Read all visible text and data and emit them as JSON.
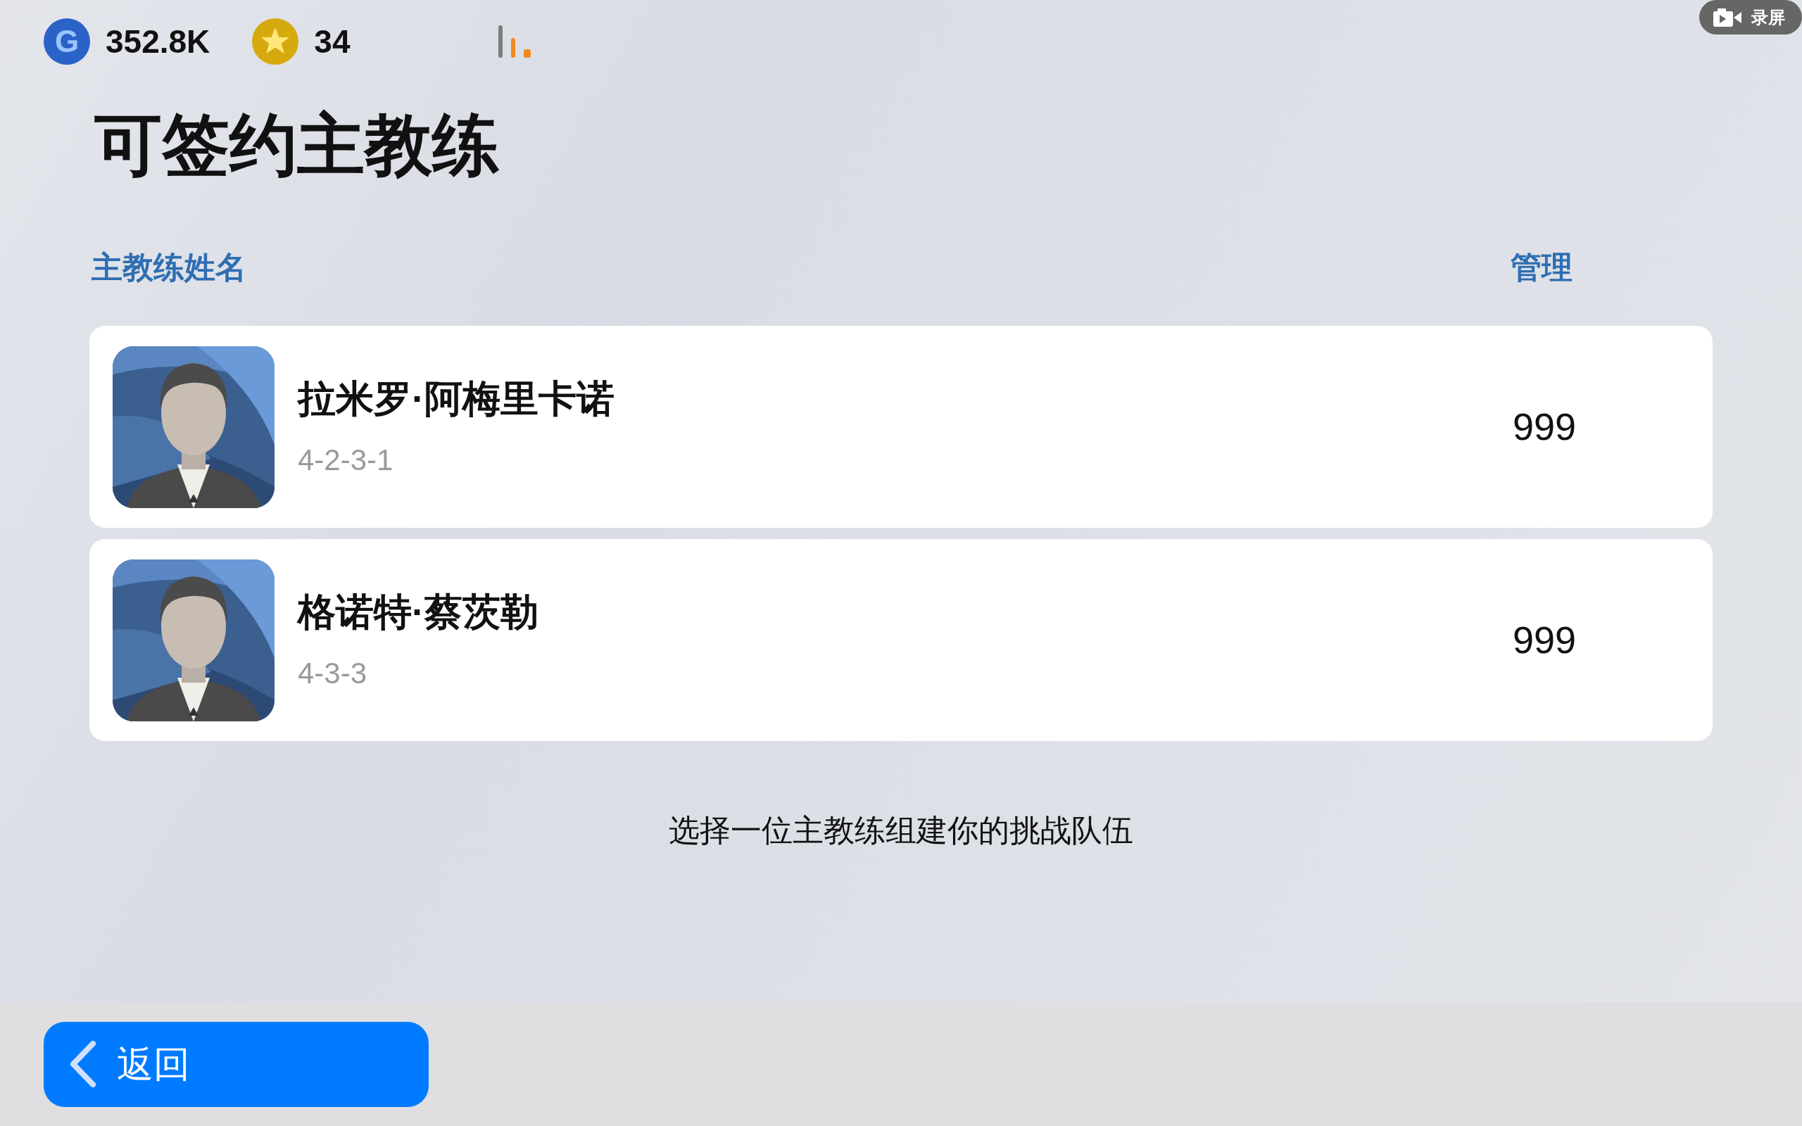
{
  "status_bar": {
    "currencies": [
      {
        "kind": "coin",
        "amount": "352.8K",
        "symbol": "G"
      },
      {
        "kind": "star",
        "amount": "34"
      }
    ]
  },
  "record_badge": {
    "label": "录屏"
  },
  "title": "可签约主教练",
  "table": {
    "columns": [
      "主教练姓名",
      "管理"
    ],
    "rows": [
      {
        "name": "拉米罗·阿梅里卡诺",
        "formation": "4-2-3-1",
        "value": "999"
      },
      {
        "name": "格诺特·蔡茨勒",
        "formation": "4-3-3",
        "value": "999"
      }
    ]
  },
  "hint": "选择一位主教练组建你的挑战队伍",
  "back_button": {
    "label": "返回"
  }
}
